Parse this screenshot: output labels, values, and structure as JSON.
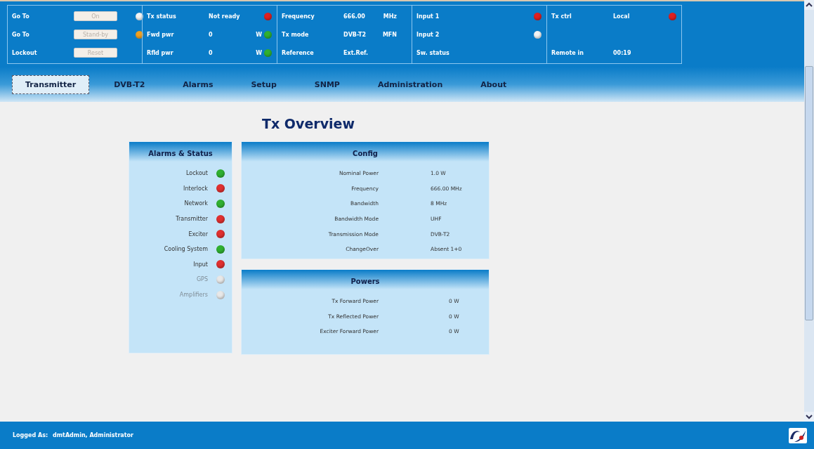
{
  "status_panels": [
    {
      "rows": [
        {
          "kind": "button",
          "label": "Go To",
          "button": "On",
          "color": "#f4f4f4"
        },
        {
          "kind": "button",
          "label": "Go To",
          "button": "Stand-by",
          "color": "#f0a020"
        },
        {
          "kind": "button",
          "label": "Lockout",
          "button": "Reset"
        }
      ]
    },
    {
      "rows": [
        {
          "kind": "reading",
          "label": "Tx status",
          "value": "Not ready",
          "color": "#e02020"
        },
        {
          "kind": "reading",
          "label": "Fwd pwr",
          "value": "0",
          "unit": "W",
          "color": "#30b030"
        },
        {
          "kind": "reading",
          "label": "Rfld pwr",
          "value": "0",
          "unit": "W",
          "color": "#30b030"
        }
      ]
    },
    {
      "rows": [
        {
          "kind": "reading",
          "label": "Frequency",
          "value": "666.00",
          "unit": "MHz"
        },
        {
          "kind": "reading",
          "label": "Tx mode",
          "value": "DVB-T2",
          "unit": "MFN"
        },
        {
          "kind": "reading",
          "label": "Reference",
          "value": "Ext.Ref."
        }
      ]
    },
    {
      "rows": [
        {
          "kind": "reading",
          "label": "Input 1",
          "color": "#e02020"
        },
        {
          "kind": "reading",
          "label": "Input 2",
          "color": "#f4f4f4"
        },
        {
          "kind": "reading",
          "label": "Sw. status"
        }
      ]
    },
    {
      "rows": [
        {
          "kind": "reading",
          "label": "Tx ctrl",
          "value": "Local",
          "color": "#e02020"
        },
        {
          "kind": "spacer"
        },
        {
          "kind": "reading",
          "label": "Remote in",
          "value": "00:19"
        }
      ]
    }
  ],
  "tabs": [
    {
      "label": "Transmitter",
      "selected": true
    },
    {
      "label": "DVB-T2",
      "selected": false
    },
    {
      "label": "Alarms",
      "selected": false
    },
    {
      "label": "Setup",
      "selected": false
    },
    {
      "label": "SNMP",
      "selected": false
    },
    {
      "label": "Administration",
      "selected": false
    },
    {
      "label": "About",
      "selected": false
    }
  ],
  "page_title": "Tx Overview",
  "alarms": {
    "title": "Alarms & Status",
    "items": [
      {
        "label": "Lockout",
        "color": "#30b030",
        "disabled": false
      },
      {
        "label": "Interlock",
        "color": "#e03030",
        "disabled": false
      },
      {
        "label": "Network",
        "color": "#30b030",
        "disabled": false
      },
      {
        "label": "Transmitter",
        "color": "#e03030",
        "disabled": false
      },
      {
        "label": "Exciter",
        "color": "#e03030",
        "disabled": false
      },
      {
        "label": "Cooling System",
        "color": "#30b030",
        "disabled": false
      },
      {
        "label": "Input",
        "color": "#e03030",
        "disabled": false
      },
      {
        "label": "GPS",
        "color": "#e8e8e8",
        "disabled": true
      },
      {
        "label": "Amplifiers",
        "color": "#e8e8e8",
        "disabled": true
      }
    ]
  },
  "config": {
    "title": "Config",
    "rows": [
      {
        "label": "Nominal Power",
        "value": "1.0 W"
      },
      {
        "label": "Frequency",
        "value": "666.00 MHz"
      },
      {
        "label": "Bandwidth",
        "value": "8 MHz"
      },
      {
        "label": "Bandwidth Mode",
        "value": "UHF"
      },
      {
        "label": "Transmission Mode",
        "value": "DVB-T2"
      },
      {
        "label": "ChangeOver",
        "value": "Absent 1+0"
      }
    ]
  },
  "powers": {
    "title": "Powers",
    "rows": [
      {
        "label": "Tx Forward Power",
        "value": "0 W"
      },
      {
        "label": "Tx Reflected Power",
        "value": "0 W"
      },
      {
        "label": "Exciter Forward Power",
        "value": "0 W"
      }
    ]
  },
  "footer": {
    "label": "Logged As:",
    "user": "dmtAdmin, Administrator"
  }
}
